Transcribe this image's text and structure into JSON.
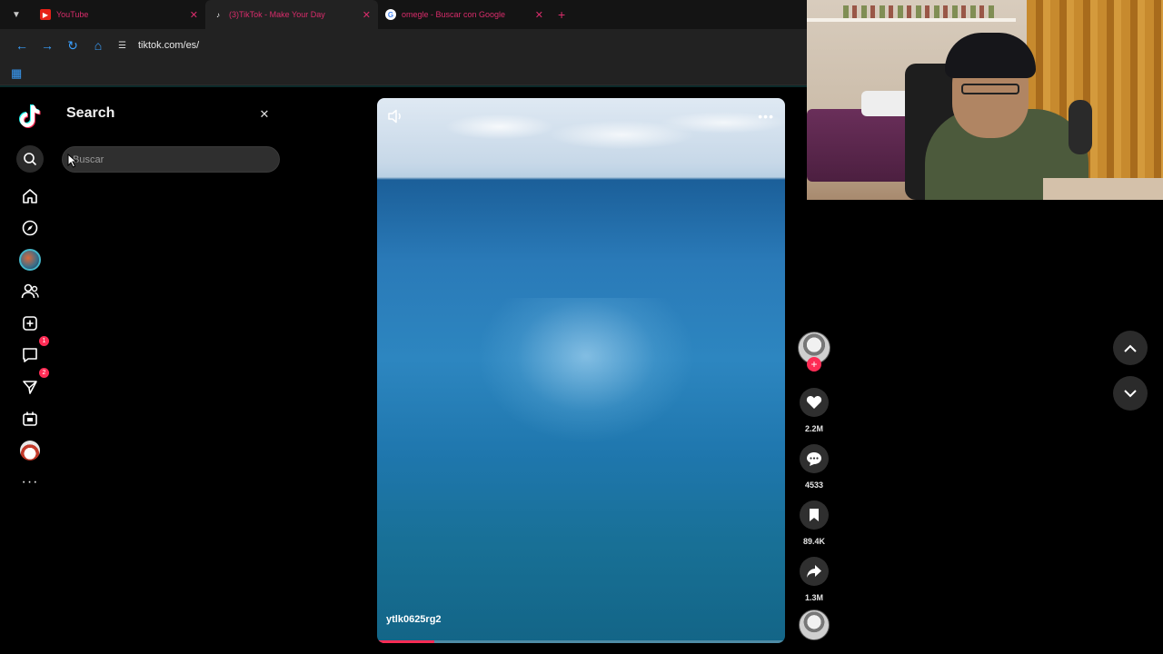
{
  "browser": {
    "tabs": [
      {
        "title": "YouTube",
        "favicon": "youtube-icon",
        "active": false
      },
      {
        "title": "(3)TikTok - Make Your Day",
        "favicon": "tiktok-icon",
        "active": true
      },
      {
        "title": "omegle - Buscar con Google",
        "favicon": "google-icon",
        "active": false
      }
    ],
    "url": "tiktok.com/es/",
    "accent_color": "#d92c6b"
  },
  "nav": {
    "items": [
      {
        "name": "search",
        "icon": "search-icon"
      },
      {
        "name": "home",
        "icon": "home-icon"
      },
      {
        "name": "explore",
        "icon": "compass-icon"
      },
      {
        "name": "live",
        "icon": "live-avatar-icon"
      },
      {
        "name": "following",
        "icon": "people-icon"
      },
      {
        "name": "upload",
        "icon": "plus-square-icon"
      },
      {
        "name": "activity",
        "icon": "chat-icon",
        "badge": "1"
      },
      {
        "name": "messages",
        "icon": "send-icon",
        "badge": "2"
      },
      {
        "name": "live-studio",
        "icon": "tv-icon"
      },
      {
        "name": "profile",
        "icon": "profile-avatar-icon"
      },
      {
        "name": "more",
        "icon": "more-icon"
      }
    ]
  },
  "search": {
    "title": "Search",
    "placeholder": "Buscar",
    "value": ""
  },
  "video": {
    "author": "ytlk0625rg2",
    "progress": 0.14
  },
  "actions": {
    "likes": "2.2M",
    "comments": "4533",
    "saves": "89.4K",
    "shares": "1.3M"
  },
  "colors": {
    "brand": "#fe2c55",
    "background": "#000000"
  }
}
